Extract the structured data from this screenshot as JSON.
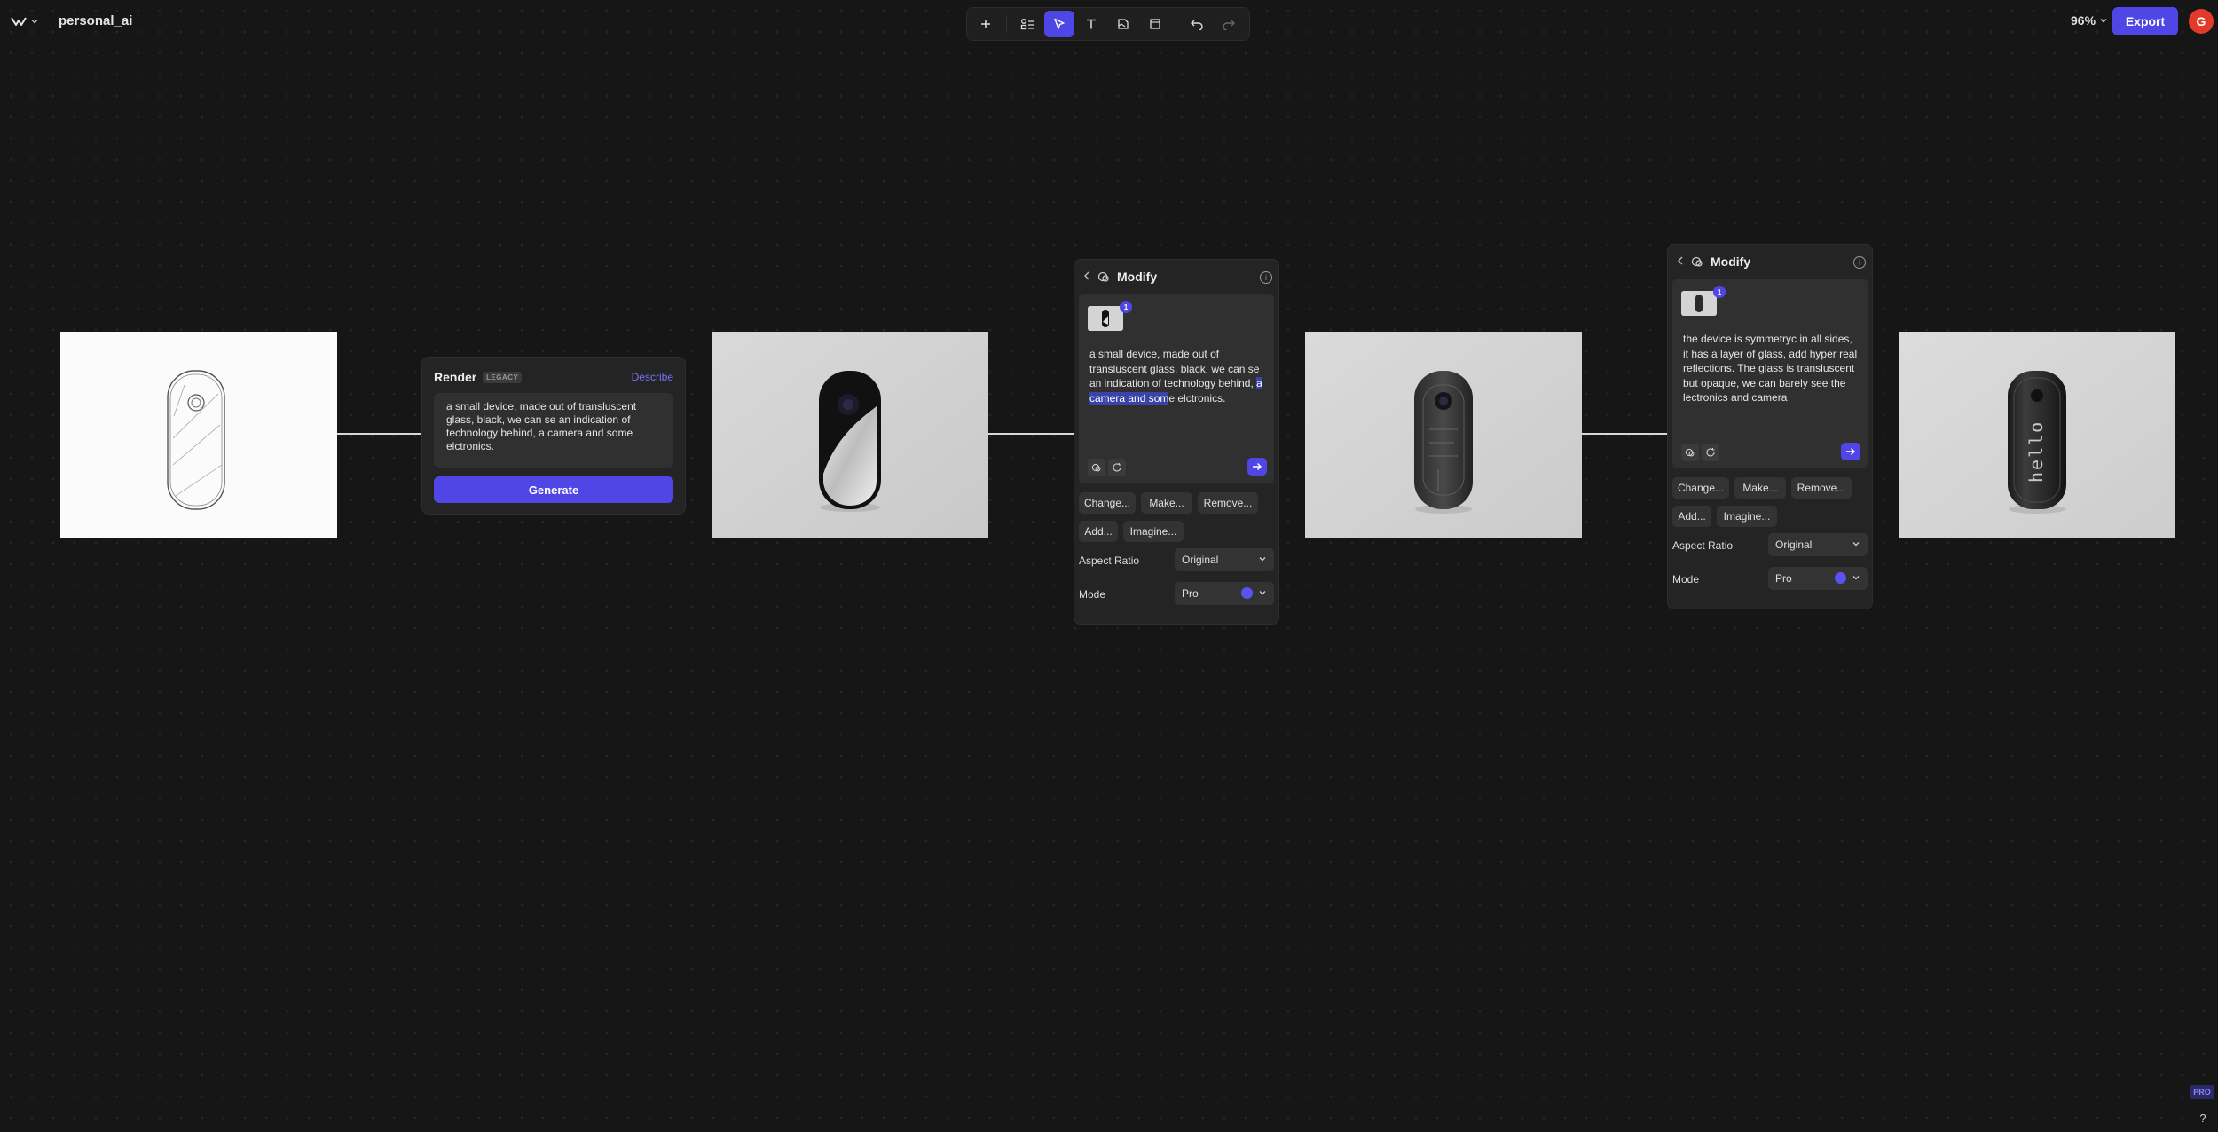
{
  "header": {
    "project_name": "personal_ai",
    "zoom": "96%",
    "export_label": "Export",
    "avatar_initial": "G"
  },
  "render_panel": {
    "title": "Render",
    "badge": "LEGACY",
    "describe_label": "Describe",
    "prompt": "a small device, made out of transluscent glass, black, we can se an indication of technology behind, a camera and some elctronics.",
    "generate_label": "Generate"
  },
  "modify_panel_1": {
    "title": "Modify",
    "thumb_badge": "1",
    "prompt_before": "a small device, made out of transluscent glass, black, we can se an indication of technology behind, ",
    "prompt_highlight": "a camera and som",
    "prompt_after": "e elctronics.",
    "chips": [
      "Change...",
      "Make...",
      "Remove...",
      "Add...",
      "Imagine..."
    ],
    "aspect_ratio_label": "Aspect Ratio",
    "aspect_ratio_value": "Original",
    "mode_label": "Mode",
    "mode_value": "Pro"
  },
  "modify_panel_2": {
    "title": "Modify",
    "thumb_badge": "1",
    "prompt": "the device is symmetryc in all sides, it has a layer of glass, add hyper real reflections. The glass is transluscent but opaque, we can barely see the lectronics and camera",
    "chips": [
      "Change...",
      "Make...",
      "Remove...",
      "Add...",
      "Imagine..."
    ],
    "aspect_ratio_label": "Aspect Ratio",
    "aspect_ratio_value": "Original",
    "mode_label": "Mode",
    "mode_value": "Pro"
  },
  "image_4_text": "hello",
  "footer": {
    "pro_badge": "PRO",
    "help": "?"
  },
  "colors": {
    "canvas": "#161616",
    "accent": "#4f46e5",
    "panel": "#242424",
    "avatar": "#e33a2c"
  },
  "icons": [
    "logo-icon",
    "chevron-down-icon",
    "plus-icon",
    "components-icon",
    "cursor-icon",
    "text-icon",
    "file-icon",
    "frame-icon",
    "undo-icon",
    "redo-icon",
    "info-icon",
    "back-icon",
    "modify-icon",
    "send-icon"
  ]
}
